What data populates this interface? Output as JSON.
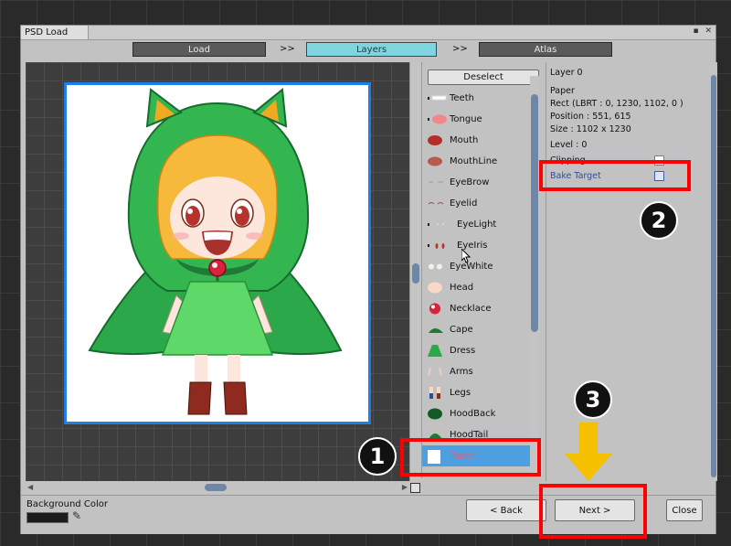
{
  "window": {
    "title": "PSD Load",
    "controls": "▪ ✕"
  },
  "steps": [
    {
      "label": "Load"
    },
    {
      "label": "Layers"
    },
    {
      "label": "Atlas"
    }
  ],
  "step_separator": ">>",
  "deselect_label": "Deselect",
  "layers": [
    {
      "name": "Teeth"
    },
    {
      "name": "Tongue"
    },
    {
      "name": "Mouth"
    },
    {
      "name": "MouthLine"
    },
    {
      "name": "EyeBrow"
    },
    {
      "name": "Eyelid"
    },
    {
      "name": "EyeLight"
    },
    {
      "name": "EyeIris"
    },
    {
      "name": "EyeWhite"
    },
    {
      "name": "Head"
    },
    {
      "name": "Necklace"
    },
    {
      "name": "Cape"
    },
    {
      "name": "Dress"
    },
    {
      "name": "Arms"
    },
    {
      "name": "Legs"
    },
    {
      "name": "HoodBack"
    },
    {
      "name": "HoodTail"
    },
    {
      "name": "Paper"
    }
  ],
  "properties": {
    "layer_index": "Layer 0",
    "name": "Paper",
    "rect": "Rect (LBRT : 0, 1230, 1102, 0 )",
    "position": "Position : 551, 615",
    "size": "Size : 1102 x 1230",
    "level": "Level : 0",
    "clipping": "Clipping",
    "bake_target": "Bake Target"
  },
  "bottom": {
    "bg_color_label": "Background Color",
    "back": "< Back",
    "next": "Next >",
    "close": "Close"
  },
  "callouts": {
    "one": "1",
    "two": "2",
    "three": "3"
  },
  "colors": {
    "active_step": "#7fd5dd",
    "highlight": "#ff0000",
    "arrow": "#f5c000",
    "selection": "#4d9fe0"
  }
}
